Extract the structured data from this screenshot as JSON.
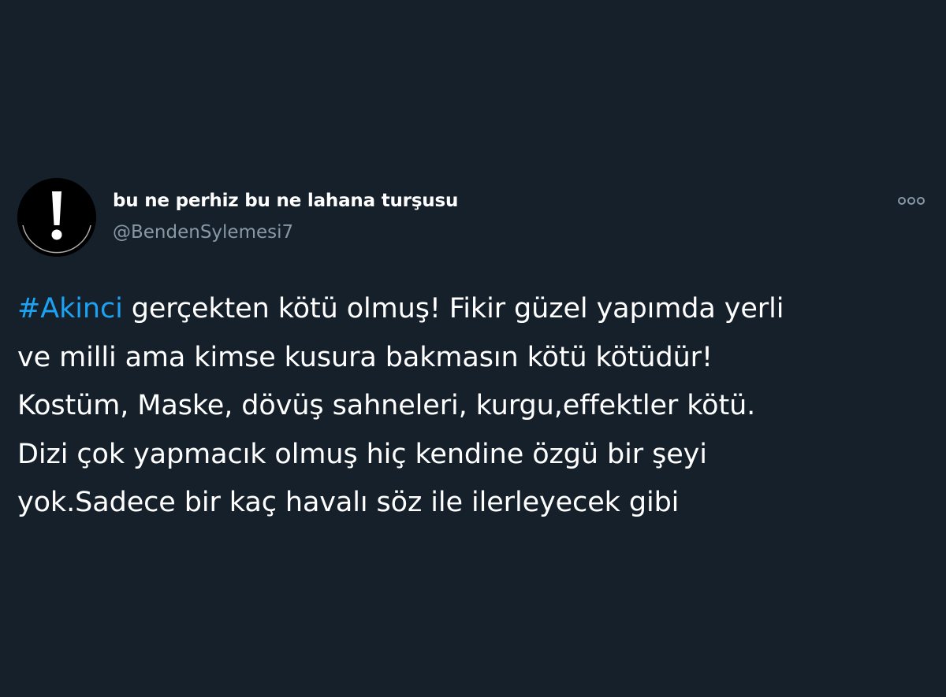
{
  "tweet": {
    "author": {
      "display_name": "bu ne perhiz bu ne lahana turşusu",
      "handle": "@BendenSylemesi7",
      "avatar_icon": "exclamation-icon"
    },
    "more_icon": "more-options-icon",
    "hashtag": "#Akinci",
    "body_text": " gerçekten kötü olmuş! Fikir güzel yapımda yerli\nve milli ama kimse kusura bakmasın kötü kötüdür!\nKostüm, Maske, dövüş sahneleri, kurgu,effektler kötü.\nDizi çok yapmacık olmuş hiç kendine özgü bir şeyi\nyok.Sadece bir kaç havalı söz ile ilerleyecek gibi"
  },
  "colors": {
    "background": "#15202b",
    "text_primary": "#ffffff",
    "text_secondary": "#8899a6",
    "accent_link": "#1da1f2"
  }
}
